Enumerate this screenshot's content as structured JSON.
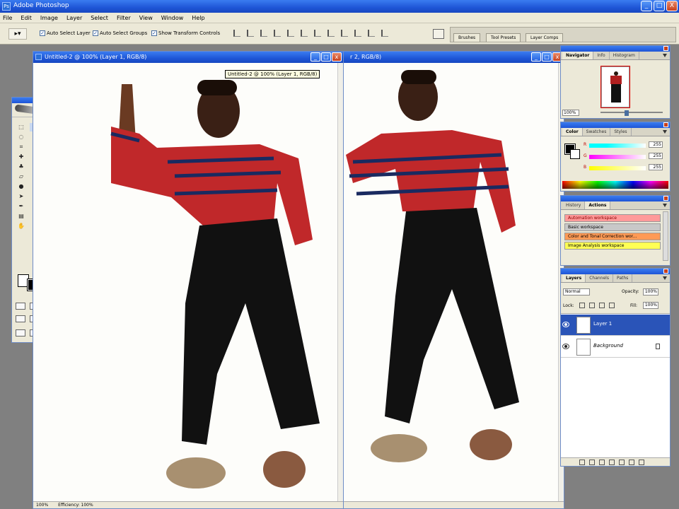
{
  "app": {
    "title": "Adobe Photoshop",
    "window_controls": [
      "_",
      "□",
      "X"
    ]
  },
  "menu": [
    "File",
    "Edit",
    "Image",
    "Layer",
    "Select",
    "Filter",
    "View",
    "Window",
    "Help"
  ],
  "options_bar": {
    "auto_select_layer": "Auto Select Layer",
    "auto_select_groups": "Auto Select Groups",
    "show_transform_controls": "Show Transform Controls",
    "well_tabs": [
      "Brushes",
      "Tool Presets",
      "Layer Comps"
    ]
  },
  "documents": {
    "left": {
      "title": "Untitled-2 @ 100% (Layer 1, RGB/8)",
      "zoom": "100%",
      "status": "Efficiency: 100%"
    },
    "right": {
      "title": "r 2, RGB/8)"
    },
    "tooltip": "Untitled-2 @ 100% (Layer 1, RGB/8)"
  },
  "navigator": {
    "tabs": [
      "Navigator",
      "Info",
      "Histogram"
    ],
    "zoom": "100%"
  },
  "color": {
    "tabs": [
      "Color",
      "Swatches",
      "Styles"
    ],
    "channels": [
      {
        "label": "R",
        "value": "255"
      },
      {
        "label": "G",
        "value": "255"
      },
      {
        "label": "B",
        "value": "255"
      }
    ]
  },
  "actions": {
    "tabs": [
      "History",
      "Actions"
    ],
    "items": [
      "Automation workspace",
      "Basic workspace",
      "Color and Tonal Correction wor...",
      "Image Analysis workspace"
    ]
  },
  "layers": {
    "tabs": [
      "Layers",
      "Channels",
      "Paths"
    ],
    "blend_mode": "Normal",
    "opacity_label": "Opacity:",
    "opacity": "100%",
    "lock_label": "Lock:",
    "fill_label": "Fill:",
    "fill": "100%",
    "items": [
      {
        "name": "Layer 1",
        "selected": true
      },
      {
        "name": "Background",
        "selected": false
      }
    ]
  },
  "colors": {
    "title_blue": "#1e55d6",
    "panel_bg": "#ece9d8",
    "selection": "#2a54b8"
  }
}
